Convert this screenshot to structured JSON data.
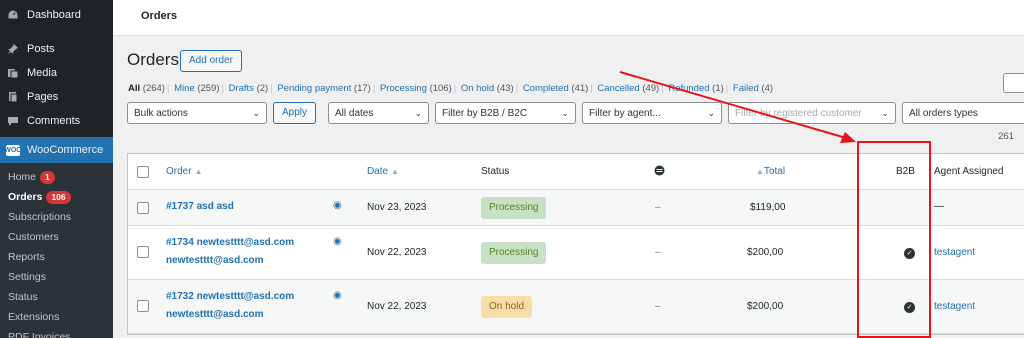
{
  "sidebar": {
    "items": [
      {
        "label": "Dashboard",
        "icon": "dashboard-icon"
      },
      {
        "label": "Posts",
        "icon": "pin-icon"
      },
      {
        "label": "Media",
        "icon": "media-icon"
      },
      {
        "label": "Pages",
        "icon": "pages-icon"
      },
      {
        "label": "Comments",
        "icon": "comment-icon"
      }
    ],
    "woocommerce": {
      "label": "WooCommerce",
      "icon_text": "WOO"
    },
    "submenu": [
      {
        "label": "Home",
        "badge": "1"
      },
      {
        "label": "Orders",
        "badge": "106"
      },
      {
        "label": "Subscriptions"
      },
      {
        "label": "Customers"
      },
      {
        "label": "Reports"
      },
      {
        "label": "Settings"
      },
      {
        "label": "Status"
      },
      {
        "label": "Extensions"
      },
      {
        "label": "PDF Invoices"
      }
    ]
  },
  "topbar": {
    "title": "Orders"
  },
  "page": {
    "heading": "Orders",
    "add_order": "Add order",
    "status_links": [
      {
        "label": "All",
        "count": "(264)"
      },
      {
        "label": "Mine",
        "count": "(259)"
      },
      {
        "label": "Drafts",
        "count": "(2)"
      },
      {
        "label": "Pending payment",
        "count": "(17)"
      },
      {
        "label": "Processing",
        "count": "(106)"
      },
      {
        "label": "On hold",
        "count": "(43)"
      },
      {
        "label": "Completed",
        "count": "(41)"
      },
      {
        "label": "Cancelled",
        "count": "(49)"
      },
      {
        "label": "Refunded",
        "count": "(1)"
      },
      {
        "label": "Failed",
        "count": "(4)"
      }
    ],
    "filters": {
      "bulk_actions": "Bulk actions",
      "apply": "Apply",
      "all_dates": "All dates",
      "b2b_filter": "Filter by B2B / B2C",
      "agent_filter": "Filter by agent...",
      "customer_placeholder": "Filter by registered customer",
      "order_types": "All orders types"
    },
    "items_count": "261"
  },
  "table": {
    "headers": {
      "order": "Order",
      "date": "Date",
      "status": "Status",
      "origin": "",
      "total": "Total",
      "b2b": "B2B",
      "agent": "Agent Assigned"
    },
    "rows": [
      {
        "order": "#1737 asd asd",
        "email": "",
        "date": "Nov 23, 2023",
        "status": "Processing",
        "origin": "–",
        "total": "$119,00",
        "b2b": false,
        "agent": "—"
      },
      {
        "order": "#1734 newtestttt@asd.com",
        "email": "newtestttt@asd.com",
        "date": "Nov 22, 2023",
        "status": "Processing",
        "origin": "–",
        "total": "$200,00",
        "b2b": true,
        "agent": "testagent"
      },
      {
        "order": "#1732 newtestttt@asd.com",
        "email": "newtestttt@asd.com",
        "date": "Nov 22, 2023",
        "status": "On hold",
        "origin": "–",
        "total": "$200,00",
        "b2b": true,
        "agent": "testagent"
      }
    ]
  },
  "colors": {
    "sidebar_bg": "#1d2327",
    "accent": "#2271b1",
    "processing_bg": "#c6e1c6",
    "onhold_bg": "#f8dda7",
    "annotation": "#e8141c"
  }
}
